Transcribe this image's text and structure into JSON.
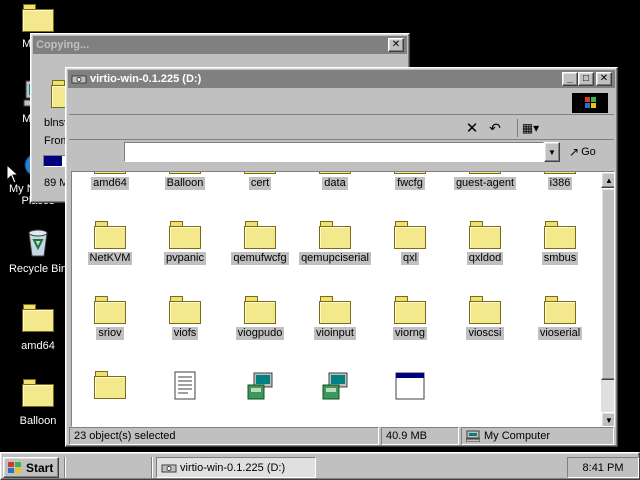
{
  "desktop": {
    "icons": [
      {
        "label": "My Do",
        "icon": "folder-icon"
      },
      {
        "label": "My Co",
        "icon": "computer-icon"
      },
      {
        "label": "My Network Places",
        "icon": "network-places-icon"
      },
      {
        "label": "Recycle Bin",
        "icon": "recycle-bin-icon"
      },
      {
        "label": "amd64",
        "icon": "folder-icon"
      },
      {
        "label": "Balloon",
        "icon": "folder-icon"
      }
    ]
  },
  "copy_dialog": {
    "title": "Copying...",
    "line1": "blnsv",
    "line2": "From",
    "progress_text": "89 M",
    "progress_fraction": 0.1
  },
  "explorer": {
    "title": "virtio-win-0.1.225 (D:)",
    "address_value": "",
    "go_label": "Go",
    "items": [
      {
        "label": "amd64",
        "type": "folder"
      },
      {
        "label": "Balloon",
        "type": "folder"
      },
      {
        "label": "cert",
        "type": "folder"
      },
      {
        "label": "data",
        "type": "folder"
      },
      {
        "label": "fwcfg",
        "type": "folder"
      },
      {
        "label": "guest-agent",
        "type": "folder"
      },
      {
        "label": "i386",
        "type": "folder"
      },
      {
        "label": "NetKVM",
        "type": "folder"
      },
      {
        "label": "pvpanic",
        "type": "folder"
      },
      {
        "label": "qemufwcfg",
        "type": "folder"
      },
      {
        "label": "qemupciserial",
        "type": "folder"
      },
      {
        "label": "qxl",
        "type": "folder"
      },
      {
        "label": "qxldod",
        "type": "folder"
      },
      {
        "label": "smbus",
        "type": "folder"
      },
      {
        "label": "sriov",
        "type": "folder"
      },
      {
        "label": "viofs",
        "type": "folder"
      },
      {
        "label": "viogpudo",
        "type": "folder"
      },
      {
        "label": "vioinput",
        "type": "folder"
      },
      {
        "label": "viorng",
        "type": "folder"
      },
      {
        "label": "vioscsi",
        "type": "folder"
      },
      {
        "label": "vioserial",
        "type": "folder"
      },
      {
        "label": "",
        "type": "folder"
      },
      {
        "label": "",
        "type": "text-file"
      },
      {
        "label": "",
        "type": "installer"
      },
      {
        "label": "",
        "type": "installer"
      },
      {
        "label": "",
        "type": "application"
      }
    ],
    "status": {
      "selection": "23 object(s) selected",
      "size": "40.9 MB",
      "zone": "My Computer"
    }
  },
  "taskbar": {
    "start_label": "Start",
    "task_label": "virtio-win-0.1.225 (D:)",
    "clock": "8:41 PM"
  },
  "colors": {
    "desktop": "#000000",
    "chrome": "#c0c0c0",
    "inactive_title": "#808080",
    "folder": "#f3e98c",
    "progress": "#000080"
  }
}
